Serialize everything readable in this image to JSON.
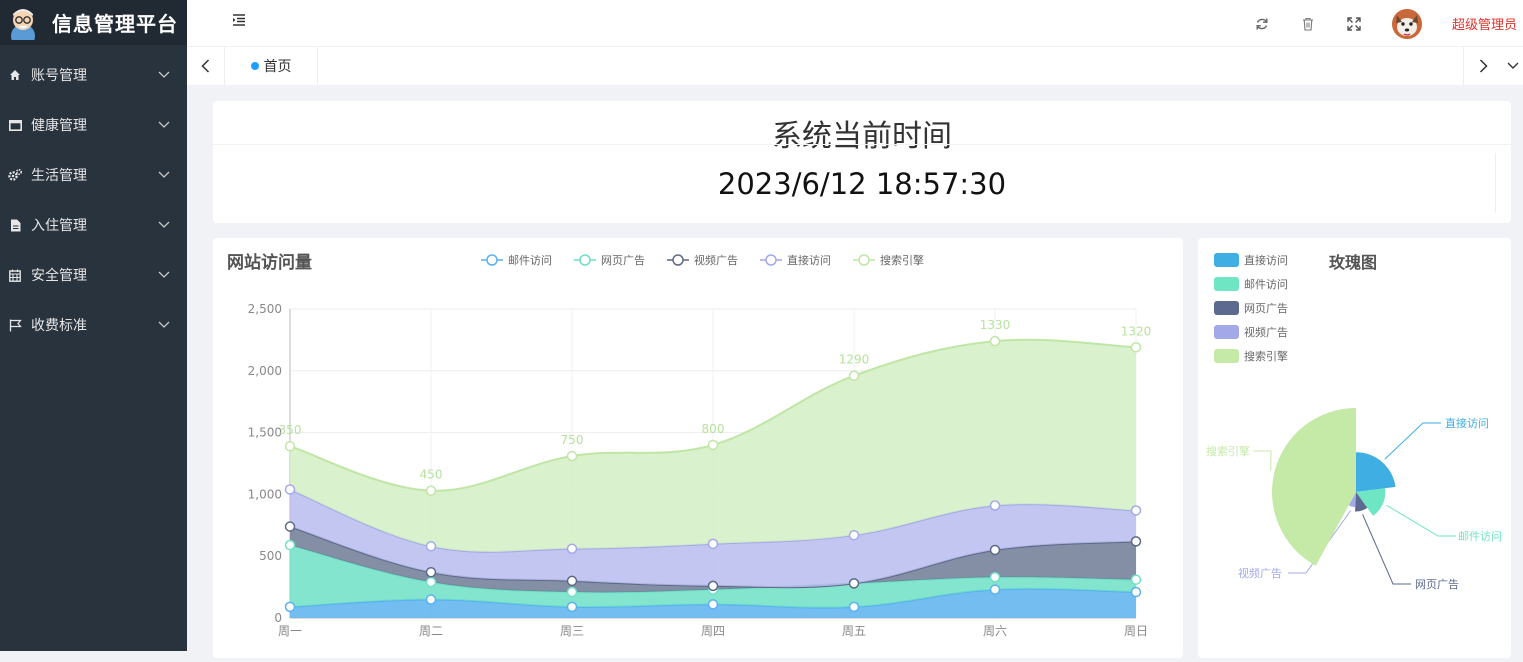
{
  "app": {
    "title": "信息管理平台"
  },
  "sidebar": {
    "items": [
      {
        "label": "账号管理",
        "icon": "home-icon"
      },
      {
        "label": "健康管理",
        "icon": "monitor-icon"
      },
      {
        "label": "生活管理",
        "icon": "gears-icon"
      },
      {
        "label": "入住管理",
        "icon": "file-icon"
      },
      {
        "label": "安全管理",
        "icon": "calendar-icon"
      },
      {
        "label": "收费标准",
        "icon": "flag-icon"
      }
    ]
  },
  "header": {
    "user": "超级管理员"
  },
  "tabs": [
    {
      "label": "首页",
      "active": true
    }
  ],
  "time_card": {
    "title": "系统当前时间",
    "value": "2023/6/12 18:57:30"
  },
  "colors": {
    "sidebar": "#28333e",
    "logo_bar": "#212a33",
    "accent": "#1e9fff",
    "admin": "#e0332c"
  },
  "chart_data": [
    {
      "type": "area",
      "title": "网站访问量",
      "stacked": true,
      "smooth": true,
      "categories": [
        "周一",
        "周二",
        "周三",
        "周四",
        "周五",
        "周六",
        "周日"
      ],
      "ylim": [
        0,
        2500
      ],
      "yticks": [
        "0",
        "500",
        "1,000",
        "1,500",
        "2,000",
        "2,500"
      ],
      "legend": "top",
      "grid": true,
      "series": [
        {
          "name": "邮件访问",
          "color": "#5ab1ef",
          "fill": "#5ab1ef",
          "values": [
            90,
            150,
            90,
            110,
            90,
            230,
            210
          ]
        },
        {
          "name": "网页广告",
          "color": "#6ee0c6",
          "fill": "#6ee0c6",
          "values": [
            500,
            140,
            120,
            120,
            190,
            100,
            100
          ]
        },
        {
          "name": "视频广告",
          "color": "#5d6a85",
          "fill": "#6e7b96",
          "values": [
            150,
            80,
            90,
            30,
            0,
            220,
            310
          ]
        },
        {
          "name": "直接访问",
          "color": "#a3a9e8",
          "fill": "#b7bcee",
          "values": [
            300,
            210,
            260,
            340,
            390,
            360,
            250
          ]
        },
        {
          "name": "搜索引擎",
          "color": "#bfe6a5",
          "fill": "#d3efc4",
          "values": [
            350,
            450,
            750,
            800,
            1290,
            1330,
            1320
          ],
          "labels": [
            "350",
            "450",
            "750",
            "800",
            "1290",
            "1330",
            "1320"
          ]
        }
      ]
    },
    {
      "type": "pie",
      "title": "玫瑰图",
      "rose": true,
      "legend": "left",
      "slices": [
        {
          "name": "直接访问",
          "value": 320,
          "color": "#3eaee3"
        },
        {
          "name": "邮件访问",
          "value": 240,
          "color": "#6ee6c4"
        },
        {
          "name": "网页广告",
          "value": 149,
          "color": "#5d6a8f"
        },
        {
          "name": "视频广告",
          "value": 100,
          "color": "#a3a9e8"
        },
        {
          "name": "搜索引擎",
          "value": 587,
          "color": "#c5eaa8"
        }
      ]
    }
  ]
}
